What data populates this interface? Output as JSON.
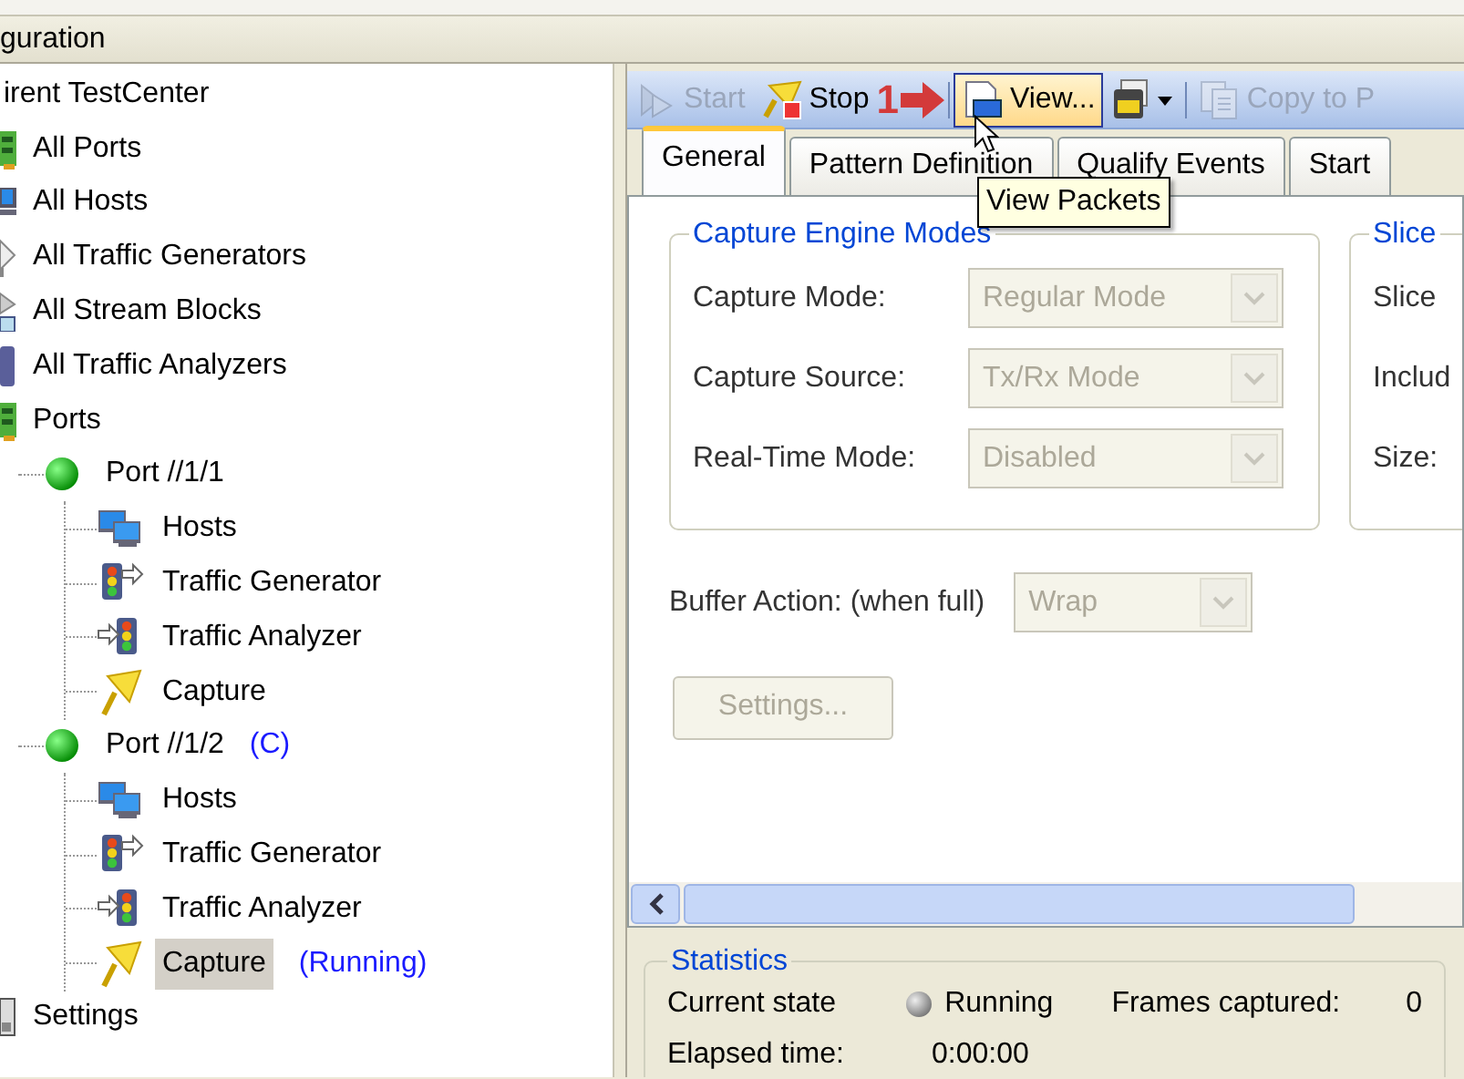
{
  "panel_title": "guration",
  "tree": [
    {
      "label": "irent TestCenter",
      "selected": false,
      "children": [
        {
          "label": "All Ports",
          "kind": "ports",
          "selected": false
        },
        {
          "label": "All Hosts",
          "kind": "hosts",
          "selected": false
        },
        {
          "label": "All Traffic Generators",
          "kind": "generators",
          "selected": false
        },
        {
          "label": "All Stream Blocks",
          "kind": "streams",
          "selected": false
        },
        {
          "label": "All Traffic Analyzers",
          "kind": "analyzers",
          "selected": false
        },
        {
          "label": "Ports",
          "kind": "ports",
          "selected": false,
          "children": [
            {
              "label": "Port //1/1",
              "kind": "port",
              "selected": false,
              "children": [
                {
                  "label": "Hosts",
                  "kind": "hosts",
                  "selected": false
                },
                {
                  "label": "Traffic Generator",
                  "kind": "generator",
                  "selected": false
                },
                {
                  "label": "Traffic Analyzer",
                  "kind": "analyzer",
                  "selected": false
                },
                {
                  "label": "Capture",
                  "kind": "capture",
                  "selected": false
                }
              ]
            },
            {
              "label": "Port //1/2",
              "kind": "port",
              "tag": "(C)",
              "selected": false,
              "children": [
                {
                  "label": "Hosts",
                  "kind": "hosts",
                  "selected": false
                },
                {
                  "label": "Traffic Generator",
                  "kind": "generator",
                  "selected": false
                },
                {
                  "label": "Traffic Analyzer",
                  "kind": "analyzer",
                  "selected": false
                },
                {
                  "label": "Capture",
                  "kind": "capture",
                  "tag": "(Running)",
                  "selected": true
                }
              ]
            }
          ]
        },
        {
          "label": "Settings",
          "kind": "settings",
          "selected": false
        }
      ]
    }
  ],
  "toolbar": [
    {
      "kind": "start",
      "label": "Start",
      "disabled": true,
      "hot": false
    },
    {
      "kind": "stop",
      "label": "Stop",
      "disabled": false,
      "hot": false
    },
    {
      "kind": "separator"
    },
    {
      "kind": "view",
      "label": "View...",
      "disabled": false,
      "hot": true
    },
    {
      "kind": "save",
      "disabled": false,
      "hot": false
    },
    {
      "kind": "separator"
    },
    {
      "kind": "copy",
      "label": "Copy to P",
      "disabled": true,
      "hot": false
    }
  ],
  "callout": {
    "label": "1"
  },
  "tooltip": "View Packets",
  "tabs": [
    {
      "label": "General",
      "selected": true
    },
    {
      "label": "Pattern Definition",
      "selected": false
    },
    {
      "label": "Qualify Events",
      "selected": false
    },
    {
      "label": "Start",
      "selected": false
    }
  ],
  "groups": [
    {
      "title": "Capture Engine Modes",
      "fields": [
        {
          "label": "Capture Mode:",
          "value": "Regular Mode",
          "disabled": true
        },
        {
          "label": "Capture Source:",
          "value": "Tx/Rx Mode",
          "disabled": true
        },
        {
          "label": "Real-Time Mode:",
          "value": "Disabled",
          "disabled": true
        }
      ]
    },
    {
      "title": "Slice",
      "fields": [
        {
          "label": "Slice"
        },
        {
          "label": "Includ"
        },
        {
          "label": "Size:"
        }
      ]
    }
  ],
  "buffer_action": {
    "label": "Buffer Action: (when full)",
    "value": "Wrap",
    "disabled": true
  },
  "settings_button": {
    "label": "Settings...",
    "disabled": true
  },
  "statistics": {
    "title": "Statistics",
    "rows": [
      [
        {
          "label": "Current state",
          "value": "Running",
          "indicator": true
        },
        {
          "label": "Frames captured:",
          "value": "0"
        }
      ],
      [
        {
          "label": "Elapsed time:",
          "value": "0:00:00"
        }
      ]
    ]
  }
}
